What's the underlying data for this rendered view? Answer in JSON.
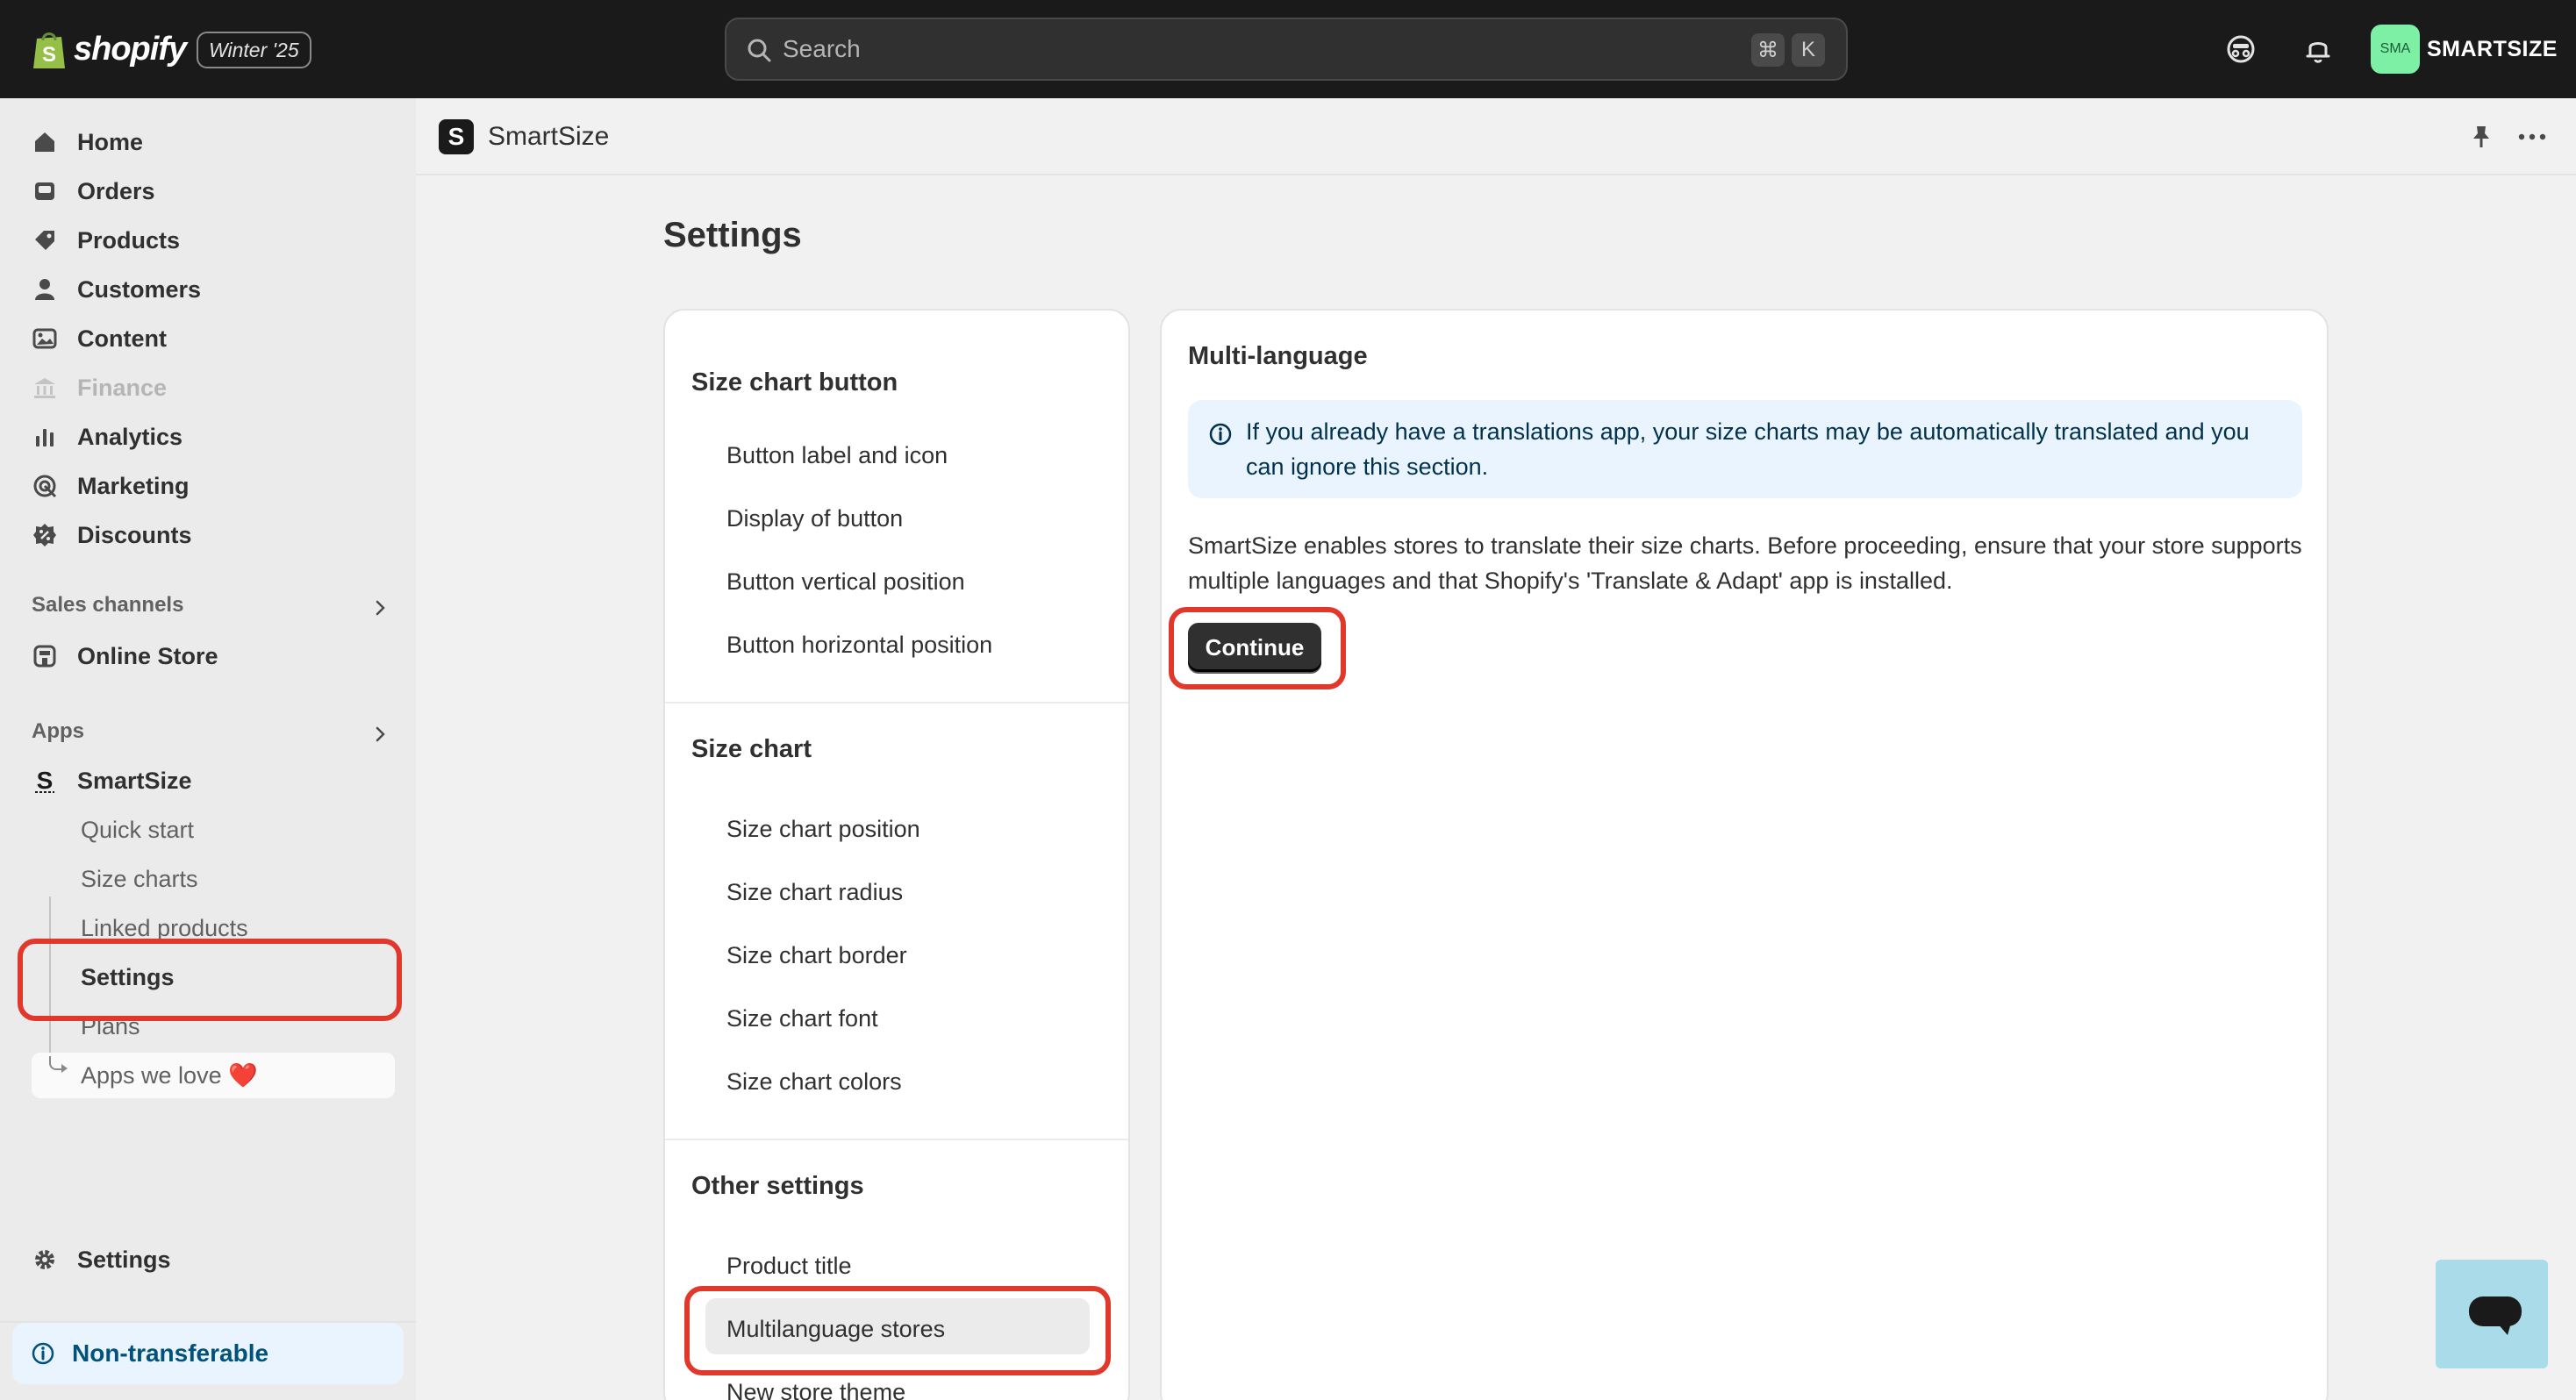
{
  "topbar": {
    "logo_text": "shopify",
    "release_badge": "Winter '25",
    "search_placeholder": "Search",
    "shortcut_keys": [
      "⌘",
      "K"
    ],
    "avatar_initials": "SMA",
    "store_name": "SMARTSIZE"
  },
  "sidebar": {
    "nav": [
      {
        "label": "Home",
        "icon": "home-icon"
      },
      {
        "label": "Orders",
        "icon": "orders-icon"
      },
      {
        "label": "Products",
        "icon": "tag-icon"
      },
      {
        "label": "Customers",
        "icon": "person-icon"
      },
      {
        "label": "Content",
        "icon": "image-icon"
      },
      {
        "label": "Finance",
        "icon": "bank-icon",
        "disabled": true
      },
      {
        "label": "Analytics",
        "icon": "bar-chart-icon"
      },
      {
        "label": "Marketing",
        "icon": "target-icon"
      },
      {
        "label": "Discounts",
        "icon": "discount-icon"
      }
    ],
    "sales_channels_label": "Sales channels",
    "online_store_label": "Online Store",
    "apps_label": "Apps",
    "app_name": "SmartSize",
    "app_sub_items": [
      "Quick start",
      "Size charts",
      "Linked products",
      "Settings",
      "Plans",
      "Apps we love ❤️"
    ],
    "active_sub_item": "Settings",
    "settings_label": "Settings",
    "non_transferable_label": "Non-transferable"
  },
  "app_header": {
    "title": "SmartSize"
  },
  "page": {
    "title": "Settings"
  },
  "settings_menu": {
    "sections": [
      {
        "title": "Size chart button",
        "links": [
          "Button label and icon",
          "Display of button",
          "Button vertical position",
          "Button horizontal position"
        ]
      },
      {
        "title": "Size chart",
        "links": [
          "Size chart position",
          "Size chart radius",
          "Size chart border",
          "Size chart font",
          "Size chart colors"
        ]
      },
      {
        "title": "Other settings",
        "links": [
          "Product title",
          "Multilanguage stores",
          "New store theme"
        ]
      }
    ],
    "active_link": "Multilanguage stores"
  },
  "multilanguage": {
    "title": "Multi-language",
    "info_banner": "If you already have a translations app, your size charts may be automatically translated and you can ignore this section.",
    "description": "SmartSize enables stores to translate their size charts. Before proceeding, ensure that your store supports multiple languages and that Shopify's 'Translate & Adapt' app is installed.",
    "continue_label": "Continue"
  },
  "colors": {
    "highlight": "#e0382a",
    "topbar": "#1a1a1a",
    "avatar": "#7df0a5",
    "banner": "#eaf4ff",
    "chat_widget": "#a9dbe8"
  }
}
